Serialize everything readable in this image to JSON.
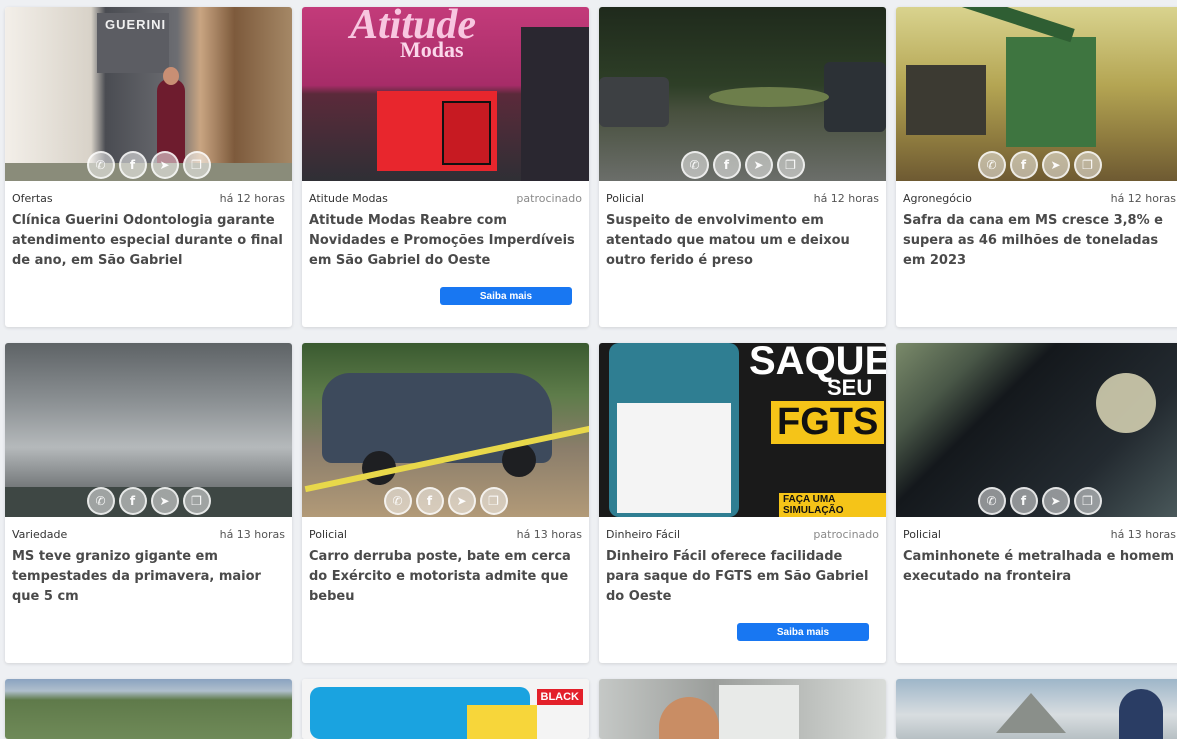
{
  "share_icons": [
    "whatsapp-icon",
    "facebook-icon",
    "telegram-icon",
    "copy-icon"
  ],
  "share_glyphs": {
    "whatsapp": "✆",
    "facebook": "f",
    "telegram": "➤",
    "copy": "❐"
  },
  "cards": [
    {
      "category": "Ofertas",
      "time": "há 12 horas",
      "title": "Clínica Guerini Odontologia garante atendimento especial durante o final de ano, em São Gabriel",
      "image_text": "GUERINI"
    },
    {
      "category": "Atitude Modas",
      "sponsor": "patrocinado",
      "title": "Atitude Modas Reabre com Novidades e Promoções Imperdíveis em São Gabriel do Oeste",
      "cta": "Saiba mais",
      "image_text": "Atitude",
      "image_text2": "Modas"
    },
    {
      "category": "Policial",
      "time": "há 12 horas",
      "title": "Suspeito de envolvimento em atentado que matou um e deixou outro ferido é preso"
    },
    {
      "category": "Agronegócio",
      "time": "há 12 horas",
      "title": "Safra da cana em MS cresce 3,8% e supera as 46 milhões de toneladas em 2023"
    },
    {
      "category": "Variedade",
      "time": "há 13 horas",
      "title": "MS teve granizo gigante em tempestades da primavera, maior que 5 cm"
    },
    {
      "category": "Policial",
      "time": "há 13 horas",
      "title": "Carro derruba poste, bate em cerca do Exército e motorista admite que bebeu"
    },
    {
      "category": "Dinheiro Fácil",
      "sponsor": "patrocinado",
      "title": "Dinheiro Fácil oferece facilidade para saque do FGTS em São Gabriel do Oeste",
      "cta": "Saiba mais",
      "image_text": "SAQUE",
      "image_text2": "SEU",
      "image_text3": "FGTS",
      "image_text4": "FAÇA UMA SIMULAÇÃO"
    },
    {
      "category": "Policial",
      "time": "há 13 horas",
      "title": "Caminhonete é metralhada e homem executado na fronteira"
    }
  ],
  "row3": [
    {
      "image_text": ""
    },
    {
      "image_text": "BLACK"
    },
    {
      "image_text": ""
    },
    {
      "image_text": ""
    }
  ]
}
